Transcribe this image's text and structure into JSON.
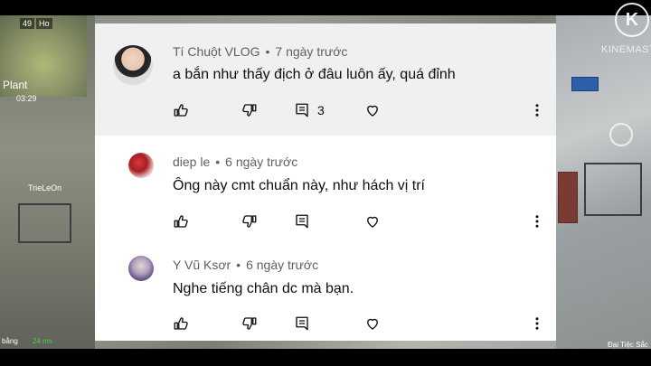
{
  "watermark": {
    "logo": "K",
    "brand": "KINEMASTER"
  },
  "game_hud": {
    "top_left_number": "49",
    "top_left_tag": "Ho",
    "plant_label": "Plant",
    "timer": "03:29",
    "player_tag": "TrieLeOn",
    "bottom_left_tag": "bằng",
    "signal": "24 ms",
    "bottom_right_text": "Đại Tiệc Sắc M"
  },
  "comments": [
    {
      "author": "Tí Chuột VLOG",
      "time": "7 ngày trước",
      "text": "a bắn như thấy địch ở đâu luôn ấy, quá đỉnh",
      "reply_count": "3",
      "highlighted": true
    },
    {
      "author": "diep le",
      "time": "6 ngày trước",
      "text": "Ông này cmt chuẩn này, như hách vị trí",
      "reply_count": ""
    },
    {
      "author": "Y Vũ Ksơr",
      "time": "6 ngày trước",
      "text": "Nghe tiếng chân dc mà bạn.",
      "reply_count": ""
    }
  ],
  "colors": {
    "panel_bg": "#ffffff",
    "highlight_bg": "#f0f0f0",
    "meta": "#606060",
    "text": "#0f0f0f"
  }
}
